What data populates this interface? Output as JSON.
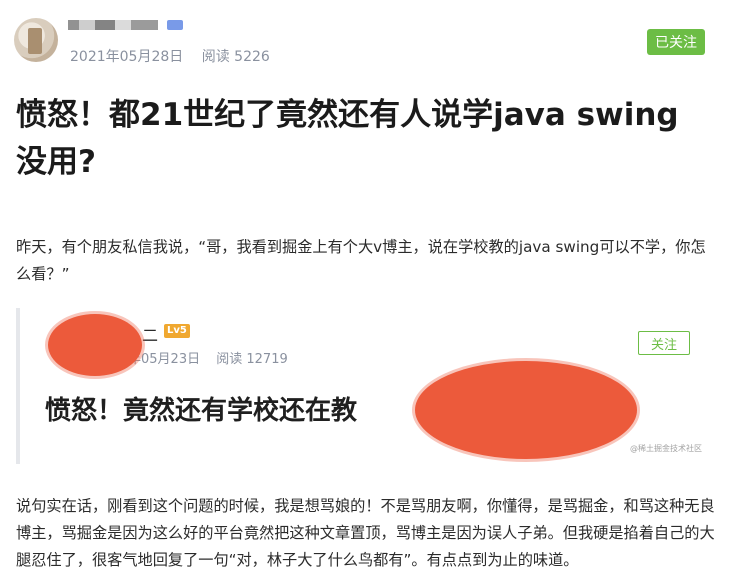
{
  "header": {
    "publish_date": "2021年05月28日",
    "read_label": "阅读",
    "read_count": "5226",
    "follow_label": "已关注",
    "follow_color": "#6cbd45"
  },
  "article": {
    "title": "愤怒！都21世纪了竟然还有人说学java swing没用?",
    "paragraph_1": "昨天，有个朋友私信我说，“哥，我看到掘金上有个大v博主，说在学校教的java swing可以不学，你怎么看？”",
    "paragraph_2": "说句实在话，刚看到这个问题的时候，我是想骂娘的！不是骂朋友啊，你懂得，是骂掘金，和骂这种无良博主，骂掘金是因为这么好的平台竟然把这种文章置顶，骂博主是因为误人子弟。但我硬是掐着自己的大腿忍住了，很客气地回复了一句“对，林子大了什么鸟都有”。有点点到为止的味道。"
  },
  "embedded_screenshot": {
    "author_name_tail": "二",
    "level_badge": "Lv5",
    "date": "年05月23日",
    "read_label": "阅读",
    "read_count": "12719",
    "follow_label": "关注",
    "title": "愤怒！竟然还有学校还在教",
    "watermark": "@稀土掘金技术社区",
    "redaction_color": "#ec5a3b"
  }
}
